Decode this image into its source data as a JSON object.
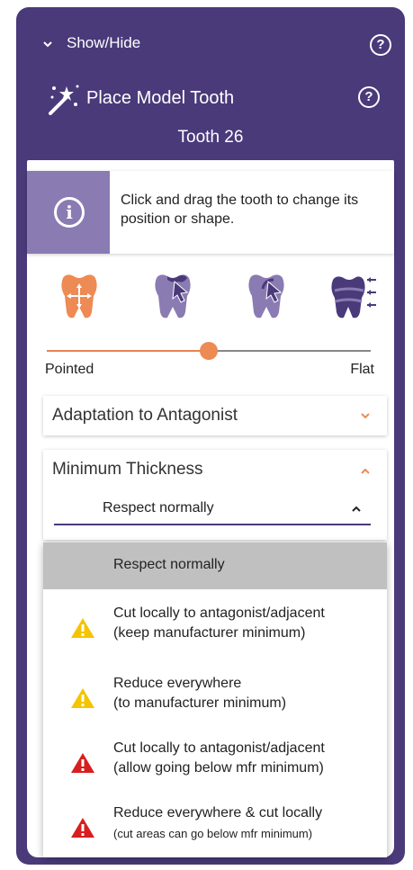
{
  "header": {
    "show_hide_label": "Show/Hide",
    "title": "Place Model Tooth",
    "tooth": "Tooth 26",
    "help_glyph": "?"
  },
  "info": {
    "glyph": "i",
    "text": "Click and drag the tooth to change its position or shape."
  },
  "tools": [
    {
      "icon": "tooth-move-icon",
      "active": true
    },
    {
      "icon": "tooth-cusp-drag-icon",
      "active": false
    },
    {
      "icon": "tooth-cusp-rotate-icon",
      "active": false
    },
    {
      "icon": "tooth-scale-icon",
      "active": false
    }
  ],
  "slider": {
    "min_label": "Pointed",
    "max_label": "Flat",
    "value": 0.5
  },
  "adaptation": {
    "label": "Adaptation to Antagonist"
  },
  "thickness": {
    "label": "Minimum Thickness",
    "selected": "Respect normally",
    "options": [
      {
        "line1": "Respect normally",
        "line2": "",
        "warning": "none"
      },
      {
        "line1": "Cut locally to antagonist/adjacent",
        "line2": "(keep manufacturer minimum)",
        "warning": "yellow"
      },
      {
        "line1": "Reduce everywhere",
        "line2": "(to manufacturer minimum)",
        "warning": "yellow"
      },
      {
        "line1": "Cut locally to antagonist/adjacent",
        "line2": "(allow going below mfr minimum)",
        "warning": "red"
      },
      {
        "line1": "Reduce everywhere & cut locally",
        "line2": "(cut areas can go below mfr minimum)",
        "warning": "red"
      }
    ]
  },
  "colors": {
    "header_bg": "#4a3a7a",
    "accent_orange": "#ee8a54",
    "tool_purple": "#8a7bb3",
    "warning_yellow": "#f5c400",
    "warning_red": "#d81e1e"
  }
}
